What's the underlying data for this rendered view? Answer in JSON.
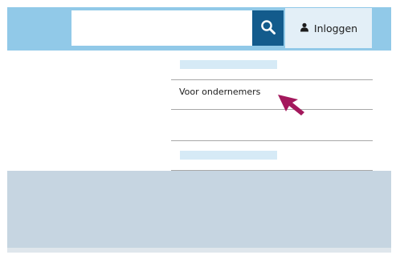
{
  "header": {
    "search": {
      "value": "",
      "placeholder": ""
    },
    "search_icon": "search-icon",
    "login": {
      "label": "Inloggen",
      "icon": "user-icon"
    }
  },
  "menu": {
    "items": [
      {
        "label": "Voor ondernemers"
      }
    ]
  },
  "pointer": {
    "icon": "cursor-arrow-icon",
    "color": "#a3185c"
  },
  "colors": {
    "header_bar": "#91c9e8",
    "search_button": "#135b8c",
    "login_button": "#e3eff7",
    "footer_band": "#c6d5e1",
    "placeholder_bar": "#d6eaf6"
  }
}
